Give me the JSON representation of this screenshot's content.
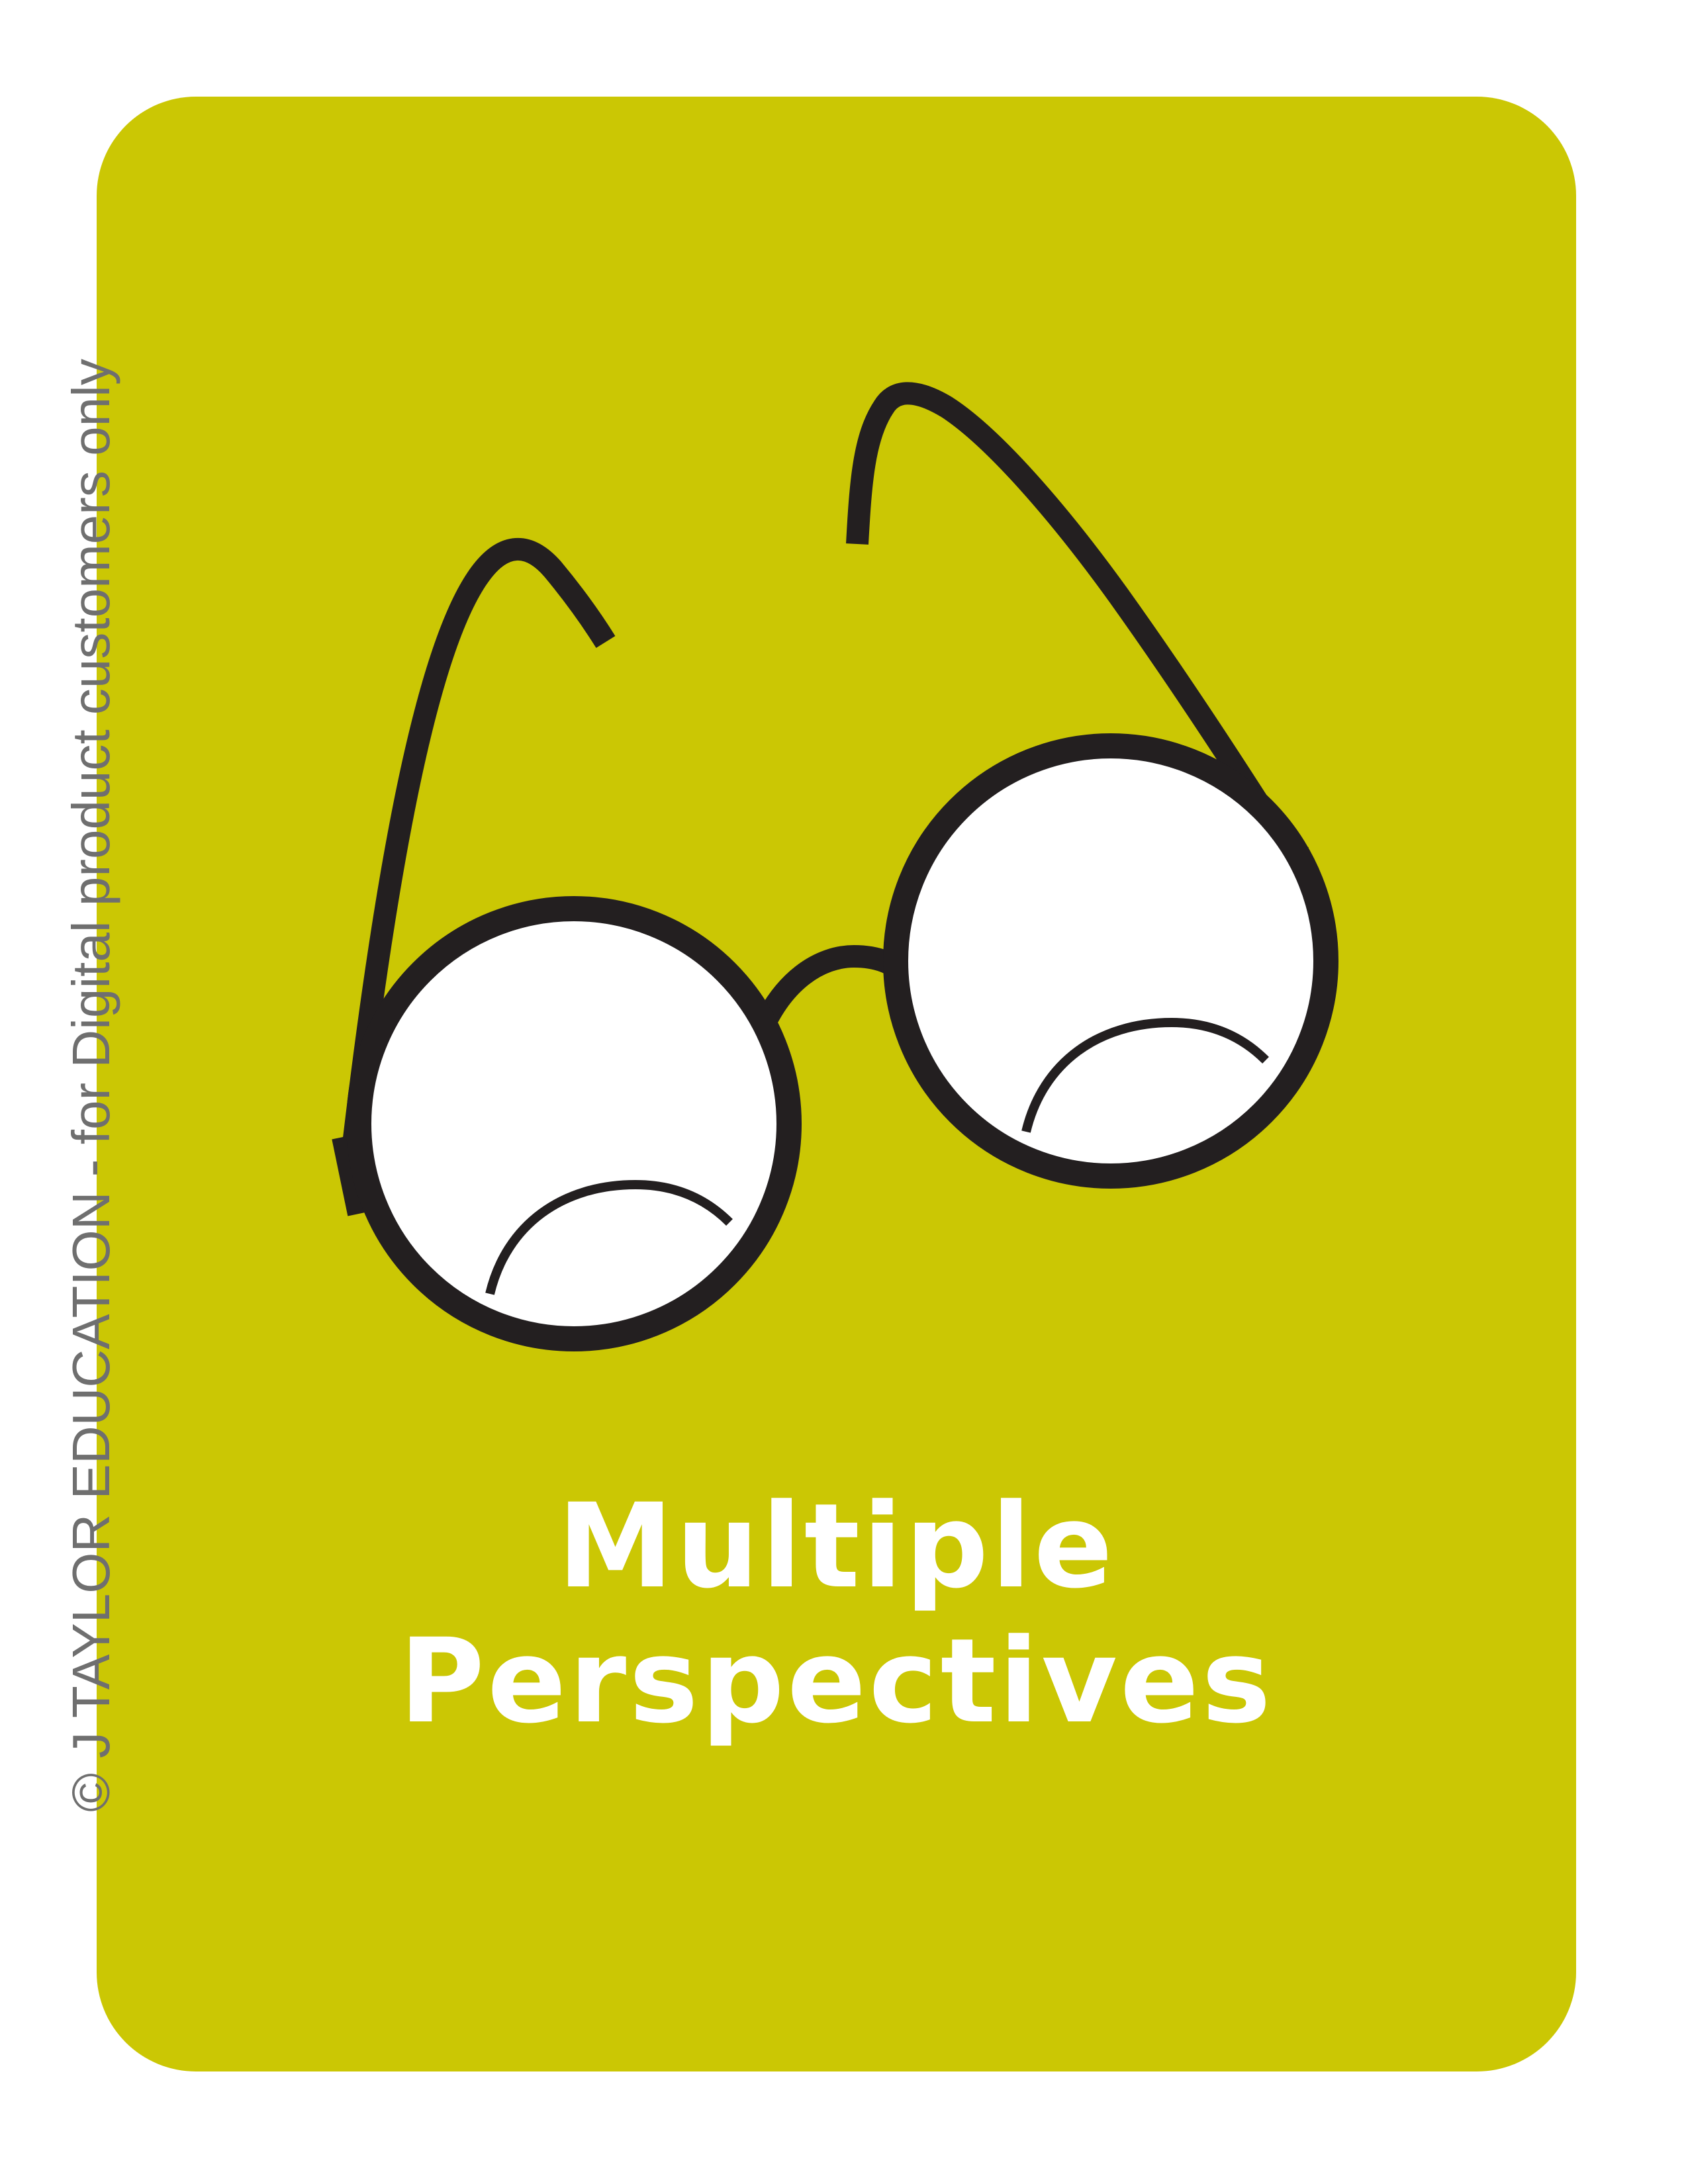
{
  "colors": {
    "card_background": "#cbc704",
    "frame": "#231f20",
    "lens": "#ffffff",
    "title_text": "#ffffff",
    "copyright_text": "#6f6f6f"
  },
  "card": {
    "illustration_icon": "round-reading-glasses-icon",
    "title_line_1": "Multiple",
    "title_line_2": "Perspectives"
  },
  "copyright": "© J TAYLOR EDUCATION - for Digital product customers only"
}
